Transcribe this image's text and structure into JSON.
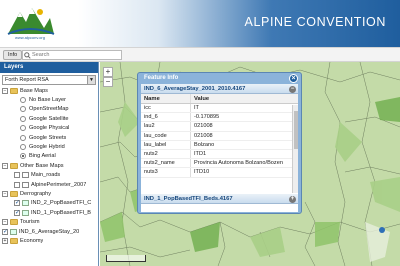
{
  "header": {
    "title": "ALPINE CONVENTION",
    "logo_url_text": "www.alpconv.org"
  },
  "toolbar": {
    "info_label": "Info",
    "search_placeholder": "Search"
  },
  "layers": {
    "title": "Layers",
    "report_select": "Forth Report RSA",
    "base_maps": {
      "label": "Base Maps",
      "items": [
        {
          "label": "No Base Layer",
          "selected": false
        },
        {
          "label": "OpenStreetMap",
          "selected": false
        },
        {
          "label": "Google Satellite",
          "selected": false
        },
        {
          "label": "Google Physical",
          "selected": false
        },
        {
          "label": "Google Streets",
          "selected": false
        },
        {
          "label": "Google Hybrid",
          "selected": false
        },
        {
          "label": "Bing Aerial",
          "selected": true
        }
      ]
    },
    "other_base_maps": {
      "label": "Other Base Maps",
      "items": [
        {
          "label": "Main_roads"
        },
        {
          "label": "AlpinePerimeter_2007"
        }
      ]
    },
    "demography": {
      "label": "Derrography",
      "items": [
        {
          "label": "IND_2_PopBasedTFI_C",
          "checked": true
        },
        {
          "label": "IND_1_PopBasedTFI_B",
          "checked": true
        }
      ]
    },
    "tourism": {
      "label": "Tourism",
      "items": [
        {
          "label": "IND_6_AverageStay_20",
          "checked": true
        }
      ]
    },
    "economy": {
      "label": "Economy"
    }
  },
  "feature_info": {
    "title": "Feature Info",
    "section1": "IND_6_AverageStay_2001_2010.4167",
    "col_name": "Name",
    "col_value": "Value",
    "rows": [
      {
        "name": "icc",
        "value": "IT"
      },
      {
        "name": "ind_6",
        "value": "-0.170895"
      },
      {
        "name": "lau2",
        "value": "021008"
      },
      {
        "name": "lau_code",
        "value": "021008"
      },
      {
        "name": "lau_label",
        "value": "Bolzano"
      },
      {
        "name": "nuts2",
        "value": "ITD1"
      },
      {
        "name": "nuts2_name",
        "value": "Provincia Autonoma Bolzano/Bozen"
      },
      {
        "name": "nuts3",
        "value": "ITD10"
      }
    ],
    "section2": "IND_1_PopBasedTFI_Beds.4167"
  },
  "map": {
    "zoom_in": "+",
    "zoom_out": "−"
  },
  "colors": {
    "brand_blue": "#1f5e9e",
    "map_green": "#cfe0b8",
    "window_blue": "#8bb3da"
  }
}
